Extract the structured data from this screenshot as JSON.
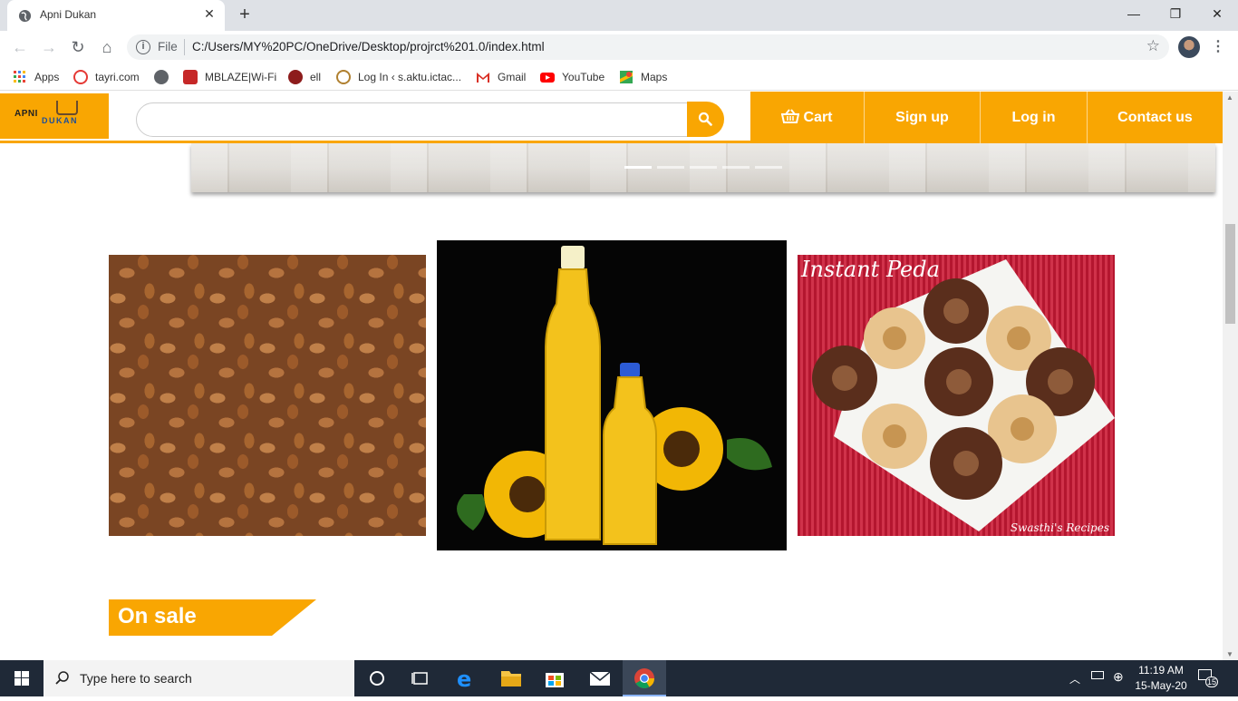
{
  "browser": {
    "tab_title": "Apni Dukan",
    "tab_close": "✕",
    "new_tab": "+",
    "win_min": "—",
    "win_restore": "❐",
    "win_close": "✕",
    "url_scheme": "File",
    "url": "C:/Users/MY%20PC/OneDrive/Desktop/projrct%201.0/index.html",
    "bookmarks": [
      {
        "label": "Apps",
        "icon": "apps-grid-icon",
        "color": "#4285f4"
      },
      {
        "label": "tayri.com",
        "icon": "tayri-icon",
        "color": "#e53935"
      },
      {
        "label": "",
        "icon": "globe-icon",
        "color": "#5f6368"
      },
      {
        "label": "MBLAZE|Wi-Fi",
        "icon": "mblaze-icon",
        "color": "#c62828"
      },
      {
        "label": "ell",
        "icon": "ell-icon",
        "color": "#8d1c1c"
      },
      {
        "label": "Log In ‹ s.aktu.ictac...",
        "icon": "aktu-icon",
        "color": "#b08030"
      },
      {
        "label": "Gmail",
        "icon": "gmail-icon",
        "color": "#d93025"
      },
      {
        "label": "YouTube",
        "icon": "youtube-icon",
        "color": "#ff0000"
      },
      {
        "label": "Maps",
        "icon": "maps-icon",
        "color": "#34a853"
      }
    ]
  },
  "site": {
    "logo_top": "APNI",
    "logo_bottom": "DUKAN",
    "search_placeholder": "",
    "nav": {
      "cart": "Cart",
      "signup": "Sign up",
      "login": "Log in",
      "contact": "Contact us"
    },
    "products": {
      "peda_caption": "Instant Peda",
      "peda_credit": "Swasthi's Recipes"
    },
    "on_sale_label": "On sale",
    "accent_color": "#f9a602"
  },
  "taskbar": {
    "search_text": "Type here to search",
    "time": "11:19 AM",
    "date": "15-May-20",
    "notifications": "15"
  }
}
